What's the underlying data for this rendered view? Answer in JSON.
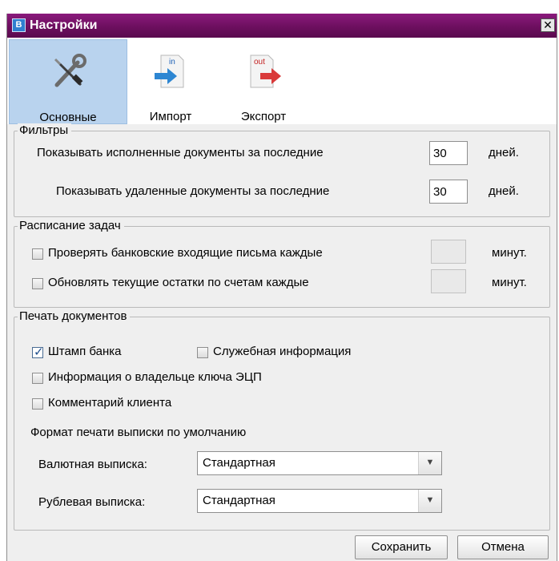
{
  "window": {
    "title": "Настройки",
    "close_glyph": "✕"
  },
  "toolbar": {
    "items": [
      {
        "label": "Основные",
        "icon": "wrench-screwdriver-icon",
        "active": true
      },
      {
        "label": "Импорт",
        "icon": "import-document-icon",
        "badge": "in"
      },
      {
        "label": "Экспорт",
        "icon": "export-document-icon",
        "badge": "out"
      }
    ]
  },
  "filters": {
    "legend": "Фильтры",
    "executed_label": "Показывать исполненные документы за последние",
    "executed_value": "30",
    "deleted_label": "Показывать удаленные документы за последние",
    "deleted_value": "30",
    "unit": "дней."
  },
  "schedule": {
    "legend": "Расписание задач",
    "check_mail_label": "Проверять банковские входящие письма каждые",
    "check_mail_value": "",
    "update_balance_label": "Обновлять текущие остатки по счетам каждые",
    "update_balance_value": "",
    "unit": "минут."
  },
  "print": {
    "legend": "Печать документов",
    "bank_stamp_label": "Штамп банка",
    "bank_stamp_checked": true,
    "service_info_label": "Служебная информация",
    "key_owner_label": "Информация о владельце ключа ЭЦП",
    "client_comment_label": "Комментарий клиента",
    "format_title": "Формат печати выписки по умолчанию",
    "currency_label": "Валютная выписка:",
    "currency_value": "Стандартная",
    "ruble_label": "Рублевая выписка:",
    "ruble_value": "Стандартная"
  },
  "buttons": {
    "save": "Сохранить",
    "cancel": "Отмена"
  },
  "colors": {
    "titlebar": "#6d0f5f",
    "active_tab": "#b9d3ee",
    "panel": "#efefef"
  }
}
